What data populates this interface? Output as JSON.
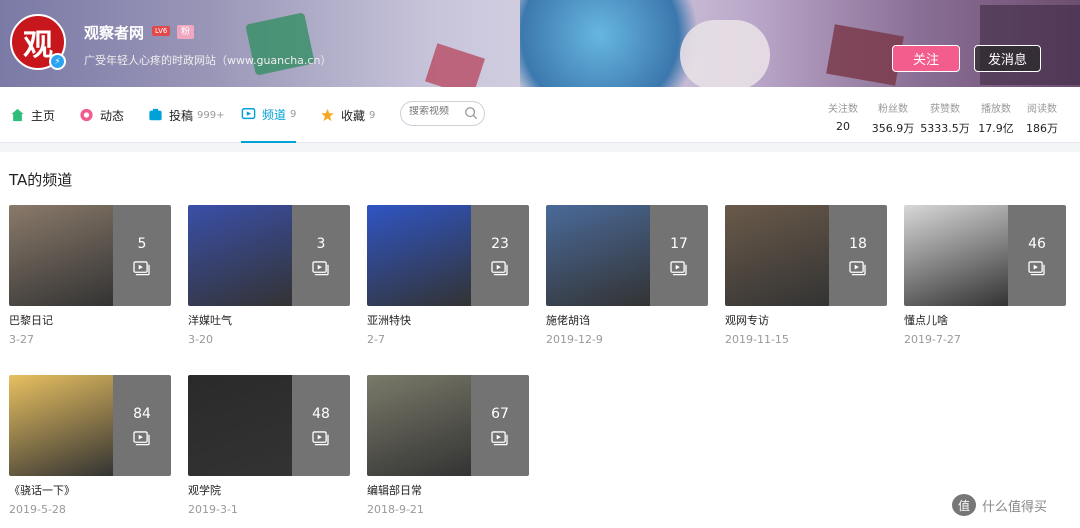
{
  "header": {
    "avatar_char": "观",
    "username": "观察者网",
    "level": "LV6",
    "fan_badge": "粉",
    "sign": "广受年轻人心疼的时政网站（www.guancha.cn）",
    "follow_label": "关注",
    "message_label": "发消息"
  },
  "nav": {
    "home": "主页",
    "dynamic": "动态",
    "videos": "投稿",
    "videos_count": "999+",
    "channels": "频道",
    "channels_count": "9",
    "favorites": "收藏",
    "favorites_count": "9",
    "search_placeholder": "搜索视频"
  },
  "stats": [
    {
      "label": "关注数",
      "value": "20"
    },
    {
      "label": "粉丝数",
      "value": "356.9万"
    },
    {
      "label": "获赞数",
      "value": "5333.5万"
    },
    {
      "label": "播放数",
      "value": "17.9亿"
    },
    {
      "label": "阅读数",
      "value": "186万"
    }
  ],
  "section_title": "TA的频道",
  "channels": [
    {
      "name": "巴黎日记",
      "date": "3-27",
      "count": "5",
      "color": "#8a7a6a"
    },
    {
      "name": "洋媒吐气",
      "date": "3-20",
      "count": "3",
      "color": "#3a4fa8"
    },
    {
      "name": "亚洲特快",
      "date": "2-7",
      "count": "23",
      "color": "#2f55c4"
    },
    {
      "name": "施佬胡诌",
      "date": "2019-12-9",
      "count": "17",
      "color": "#4a6a9a"
    },
    {
      "name": "观网专访",
      "date": "2019-11-15",
      "count": "18",
      "color": "#6a5a4a"
    },
    {
      "name": "懂点儿啥",
      "date": "2019-7-27",
      "count": "46",
      "color": "#d8d8d8"
    },
    {
      "name": "《骁话一下》",
      "date": "2019-5-28",
      "count": "84",
      "color": "#e8c060"
    },
    {
      "name": "观学院",
      "date": "2019-3-1",
      "count": "48",
      "color": "#2a2a2a"
    },
    {
      "name": "编辑部日常",
      "date": "2018-9-21",
      "count": "67",
      "color": "#7a7a6a"
    }
  ],
  "watermark": {
    "icon": "值",
    "text": "什么值得买"
  },
  "colors": {
    "accent": "#00a1d6",
    "follow": "#f25d8e"
  }
}
